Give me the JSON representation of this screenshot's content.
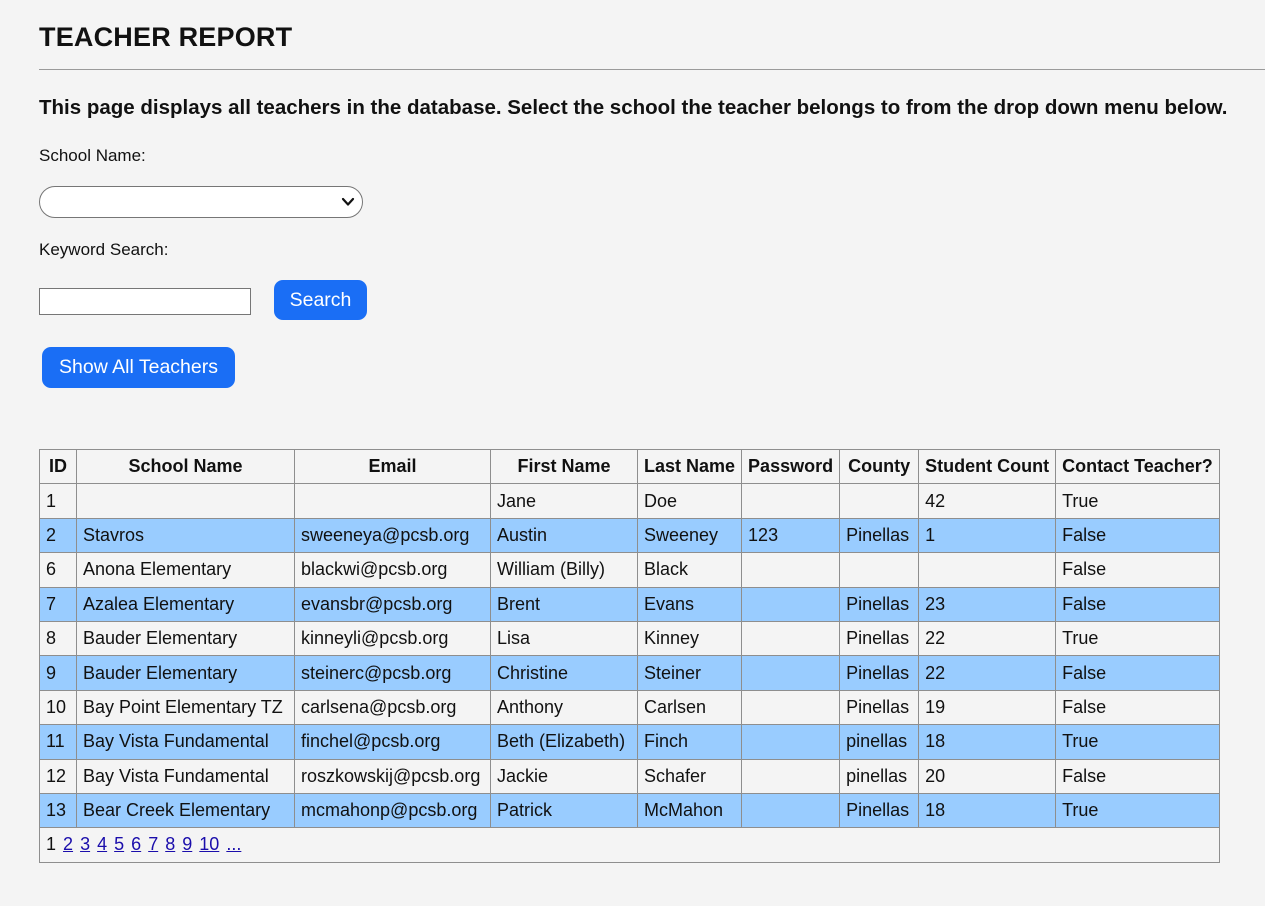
{
  "page": {
    "title": "TEACHER REPORT",
    "intro": "This page displays all teachers in the database. Select the school the teacher belongs to from the drop down menu below.",
    "school_label": "School Name:",
    "school_value": "",
    "keyword_label": "Keyword Search:",
    "keyword_value": "",
    "search_button": "Search",
    "show_all_button": "Show All Teachers"
  },
  "table": {
    "headers": [
      "ID",
      "School Name",
      "Email",
      "First Name",
      "Last Name",
      "Password",
      "County",
      "Student Count",
      "Contact Teacher?"
    ],
    "rows": [
      [
        "1",
        "",
        "",
        "Jane",
        "Doe",
        "",
        "",
        "42",
        "True"
      ],
      [
        "2",
        "Stavros",
        "sweeneya@pcsb.org",
        "Austin",
        "Sweeney",
        "123",
        "Pinellas",
        "1",
        "False"
      ],
      [
        "6",
        "Anona Elementary",
        "blackwi@pcsb.org",
        "William (Billy)",
        "Black",
        "",
        "",
        "",
        "False"
      ],
      [
        "7",
        "Azalea Elementary",
        "evansbr@pcsb.org",
        "Brent",
        "Evans",
        "",
        "Pinellas",
        "23",
        "False"
      ],
      [
        "8",
        "Bauder Elementary",
        "kinneyli@pcsb.org",
        "Lisa",
        "Kinney",
        "",
        "Pinellas",
        "22",
        "True"
      ],
      [
        "9",
        "Bauder Elementary",
        "steinerc@pcsb.org",
        "Christine",
        "Steiner",
        "",
        "Pinellas",
        "22",
        "False"
      ],
      [
        "10",
        "Bay Point Elementary TZ",
        "carlsena@pcsb.org",
        "Anthony",
        "Carlsen",
        "",
        "Pinellas",
        "19",
        "False"
      ],
      [
        "11",
        "Bay Vista Fundamental",
        "finchel@pcsb.org",
        "Beth (Elizabeth)",
        "Finch",
        "",
        "pinellas",
        "18",
        "True"
      ],
      [
        "12",
        "Bay Vista Fundamental",
        "roszkowskij@pcsb.org",
        "Jackie",
        "Schafer",
        "",
        "pinellas",
        "20",
        "False"
      ],
      [
        "13",
        "Bear Creek Elementary",
        "mcmahonp@pcsb.org",
        "Patrick",
        "McMahon",
        "",
        "Pinellas",
        "18",
        "True"
      ]
    ],
    "pager": {
      "current": "1",
      "pages": [
        "2",
        "3",
        "4",
        "5",
        "6",
        "7",
        "8",
        "9",
        "10",
        "..."
      ]
    }
  },
  "colors": {
    "background": "#f4f4f4",
    "button": "#1a6ef5",
    "alt_row": "#99ccff",
    "link": "#1a0dab"
  },
  "icons": {
    "select": "chevron-down-icon"
  }
}
